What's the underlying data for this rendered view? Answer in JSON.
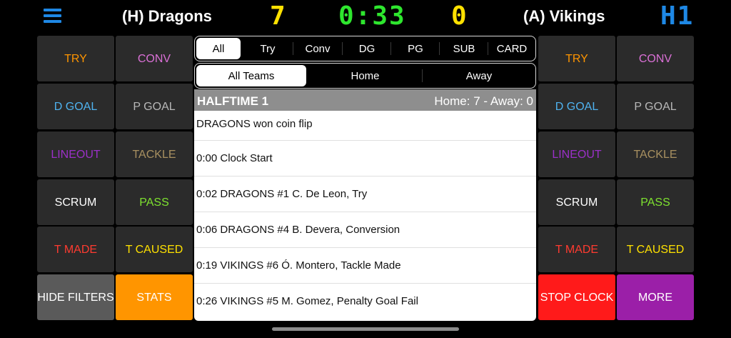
{
  "scoreboard": {
    "home_team": "(H) Dragons",
    "home_score": "7",
    "clock": "0:33",
    "away_score": "0",
    "away_team": "(A) Vikings",
    "half": "H1"
  },
  "left_buttons": [
    {
      "label": "TRY",
      "color": "#ff9500"
    },
    {
      "label": "CONV",
      "color": "#da70d6"
    },
    {
      "label": "D GOAL",
      "color": "#4fb3f0"
    },
    {
      "label": "P GOAL",
      "color": "#b8b8b8"
    },
    {
      "label": "LINEOUT",
      "color": "#9b30c8"
    },
    {
      "label": "TACKLE",
      "color": "#a89060"
    },
    {
      "label": "SCRUM",
      "color": "#ffffff"
    },
    {
      "label": "PASS",
      "color": "#7ee22f"
    },
    {
      "label": "T MADE",
      "color": "#ff3b30"
    },
    {
      "label": "T CAUSED",
      "color": "#ffe100"
    }
  ],
  "left_bottom": {
    "hide_filters": "HIDE FILTERS",
    "stats": "STATS"
  },
  "right_buttons": [
    {
      "label": "TRY",
      "color": "#ff9500"
    },
    {
      "label": "CONV",
      "color": "#da70d6"
    },
    {
      "label": "D GOAL",
      "color": "#4fb3f0"
    },
    {
      "label": "P GOAL",
      "color": "#b8b8b8"
    },
    {
      "label": "LINEOUT",
      "color": "#9b30c8"
    },
    {
      "label": "TACKLE",
      "color": "#a89060"
    },
    {
      "label": "SCRUM",
      "color": "#ffffff"
    },
    {
      "label": "PASS",
      "color": "#7ee22f"
    },
    {
      "label": "T MADE",
      "color": "#ff3b30"
    },
    {
      "label": "T CAUSED",
      "color": "#ffe100"
    }
  ],
  "right_bottom": {
    "stop_clock": "STOP CLOCK",
    "more": "MORE"
  },
  "event_filter": {
    "options": [
      "All",
      "Try",
      "Conv",
      "DG",
      "PG",
      "SUB",
      "CARD"
    ],
    "selected": "All"
  },
  "team_filter": {
    "options": [
      "All Teams",
      "Home",
      "Away"
    ],
    "selected": "All Teams"
  },
  "log": {
    "section_title": "HALFTIME 1",
    "section_score": "Home: 7 - Away: 0",
    "entries": [
      "DRAGONS won coin flip",
      "0:00 Clock Start",
      "0:02 DRAGONS #1 C. De Leon, Try",
      "0:06 DRAGONS #4 B. Devera, Conversion",
      "0:19 VIKINGS #6 Ó. Montero, Tackle Made",
      "0:26 VIKINGS #5 M. Gomez, Penalty Goal Fail"
    ]
  },
  "colors": {
    "menu": "#1e88e5",
    "home_score": "#ffe100",
    "clock": "#2ee62e",
    "away_score": "#ffe100",
    "half": "#1e88e5",
    "stats_bg": "#ff9500",
    "stop_bg": "#ff1a1a",
    "more_bg": "#9b1fa8",
    "hide_bg": "#5a5a5a"
  }
}
